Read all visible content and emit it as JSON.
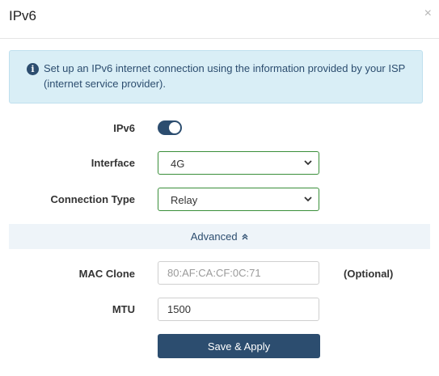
{
  "dialog": {
    "title": "IPv6",
    "close_glyph": "×"
  },
  "info": {
    "icon": "info-circle-icon",
    "text": "Set up an IPv6 internet connection using the information provided by your ISP (internet service provider)."
  },
  "form": {
    "ipv6": {
      "label": "IPv6",
      "enabled": true
    },
    "interface": {
      "label": "Interface",
      "value": "4G"
    },
    "connection_type": {
      "label": "Connection Type",
      "value": "Relay"
    },
    "advanced": {
      "label": "Advanced",
      "expanded": true,
      "icon": "double-chevron-up-icon"
    },
    "mac_clone": {
      "label": "MAC Clone",
      "placeholder": "80:AF:CA:CF:0C:71",
      "hint": "(Optional)"
    },
    "mtu": {
      "label": "MTU",
      "value": "1500"
    },
    "save_label": "Save & Apply"
  },
  "colors": {
    "primary": "#2c4d6f",
    "info_bg": "#d9eef6",
    "select_border": "#3a8f3a",
    "advanced_bg": "#eef4f9"
  }
}
